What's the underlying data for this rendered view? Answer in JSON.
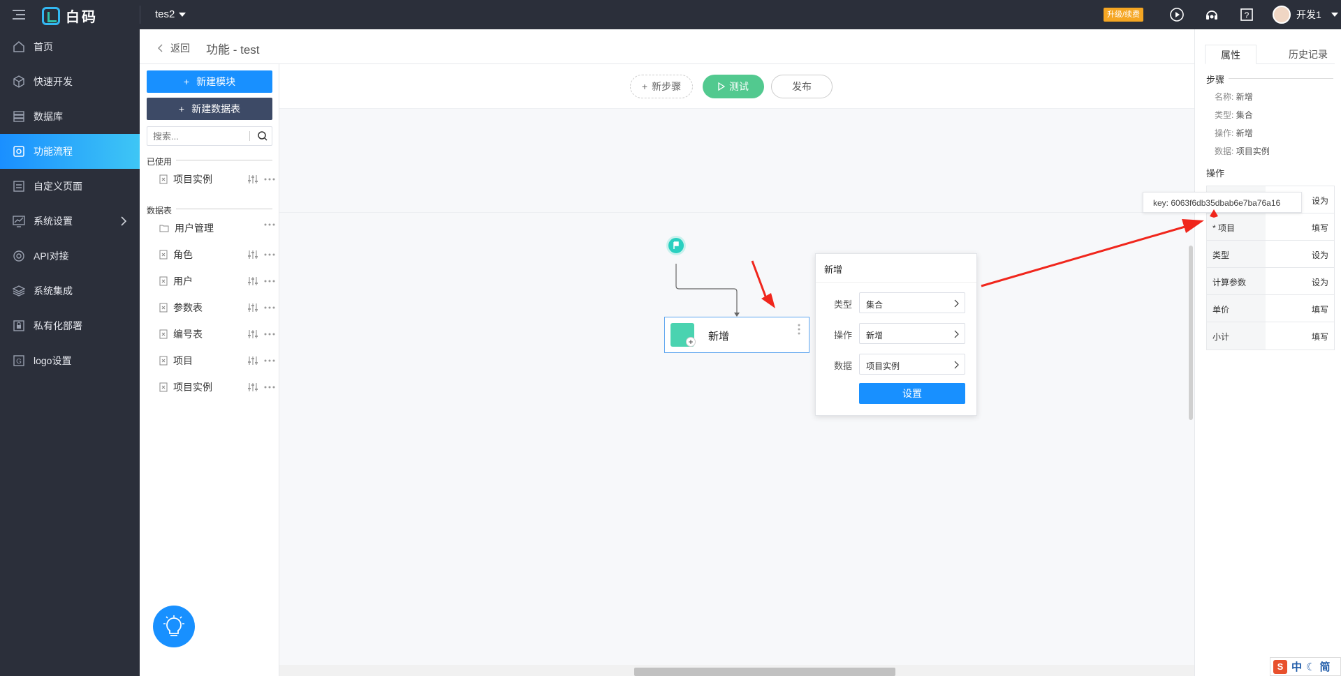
{
  "topbar": {
    "app_name": "白码",
    "project": "tes2",
    "upgrade_label": "升级/续费",
    "user_name": "开发1"
  },
  "sidebar": {
    "items": [
      {
        "label": "首页",
        "icon": "home-icon"
      },
      {
        "label": "快速开发",
        "icon": "cube-icon"
      },
      {
        "label": "数据库",
        "icon": "database-icon"
      },
      {
        "label": "功能流程",
        "icon": "flow-icon",
        "active": true
      },
      {
        "label": "自定义页面",
        "icon": "page-icon"
      },
      {
        "label": "系统设置",
        "icon": "settings-chart-icon"
      },
      {
        "label": "API对接",
        "icon": "api-icon"
      },
      {
        "label": "系统集成",
        "icon": "layers-icon"
      },
      {
        "label": "私有化部署",
        "icon": "lock-icon"
      },
      {
        "label": "logo设置",
        "icon": "logo-icon"
      }
    ]
  },
  "header": {
    "back_label": "返回",
    "title": "功能 - test"
  },
  "leftpanel": {
    "new_module": "新建模块",
    "new_table": "新建数据表",
    "search_placeholder": "搜索...",
    "used_title": "已使用",
    "used_items": [
      "项目实例"
    ],
    "tables_title": "数据表",
    "tables": [
      "用户管理",
      "角色",
      "用户",
      "参数表",
      "编号表",
      "项目",
      "项目实例"
    ]
  },
  "canvas": {
    "new_step": "新步骤",
    "test": "测试",
    "publish": "发布",
    "node_label": "新增"
  },
  "popup": {
    "title": "新增",
    "rows": [
      {
        "label": "类型",
        "value": "集合"
      },
      {
        "label": "操作",
        "value": "新增"
      },
      {
        "label": "数据",
        "value": "项目实例"
      }
    ],
    "button": "设置"
  },
  "rightpanel": {
    "tab_props": "属性",
    "tab_history": "历史记录",
    "step_title": "步骤",
    "step_fields": [
      {
        "k": "名称:",
        "v": "新增"
      },
      {
        "k": "类型:",
        "v": "集合"
      },
      {
        "k": "操作:",
        "v": "新增"
      },
      {
        "k": "数据:",
        "v": "项目实例"
      }
    ],
    "op_title": "操作",
    "op_rows": [
      {
        "name": "",
        "val": "设为"
      },
      {
        "name": "* 项目",
        "val": "填写"
      },
      {
        "name": "类型",
        "val": "设为"
      },
      {
        "name": "计算参数",
        "val": "设为"
      },
      {
        "name": "单价",
        "val": "填写"
      },
      {
        "name": "小计",
        "val": "填写"
      }
    ]
  },
  "tooltip": {
    "text": "key: 6063f6db35dbab6e7ba76a16"
  },
  "ime": {
    "s": "S",
    "zh": "中",
    "simplified": "简"
  },
  "colors": {
    "sidebar_bg": "#2b2f3a",
    "accent": "#1890ff",
    "test_green": "#52c98f",
    "annotation_red": "#f0261c"
  }
}
